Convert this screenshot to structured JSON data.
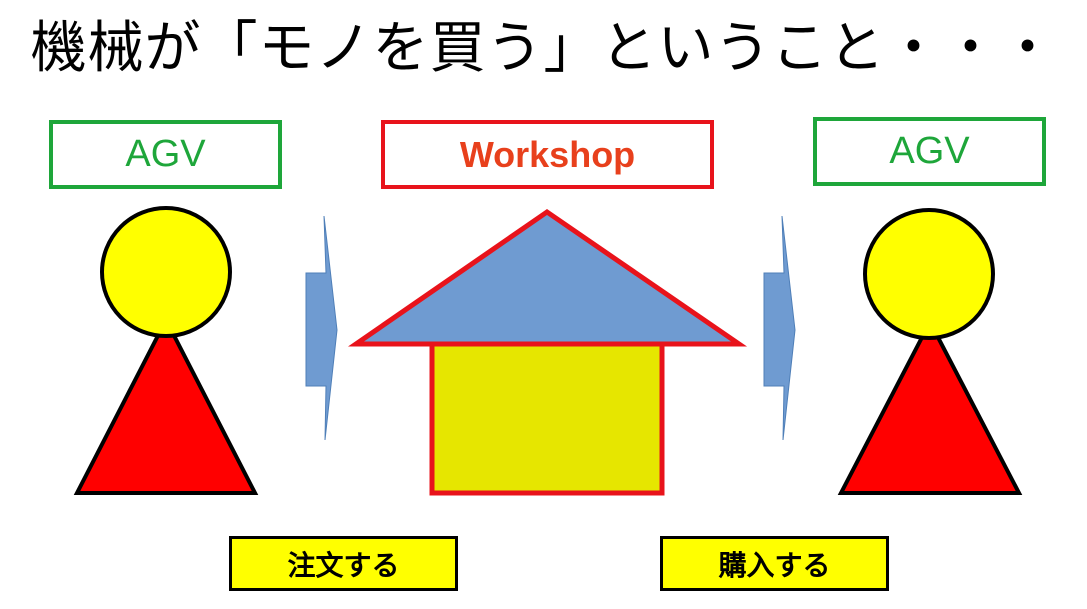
{
  "title": "機械が「モノを買う」ということ・・・",
  "left_agent": {
    "label": "AGV"
  },
  "center": {
    "label": "Workshop"
  },
  "right_agent": {
    "label": "AGV"
  },
  "actions": {
    "order": "注文する",
    "purchase": "購入する"
  },
  "colors": {
    "agv_label": "#1ea63a",
    "workshop_border": "#e8131b",
    "workshop_text": "#e8401c",
    "person_head": "#ffff00",
    "person_body": "#ff0000",
    "roof": "#6f9bd1",
    "house_body": "#e6e600",
    "arrow": "#6f9bd1",
    "action_box": "#ffff00"
  }
}
